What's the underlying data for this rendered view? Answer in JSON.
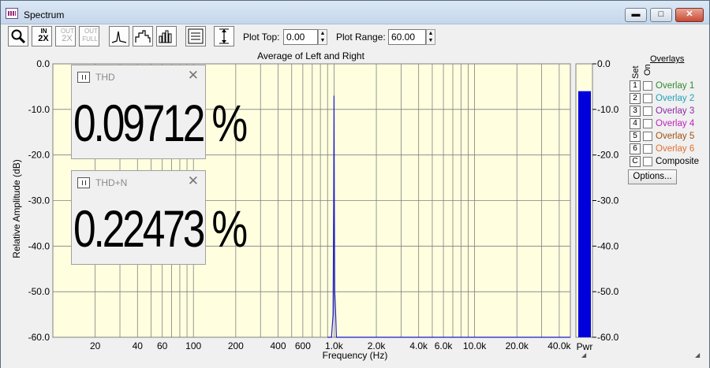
{
  "window": {
    "title": "Spectrum",
    "minimize": "▬",
    "maximize": "□",
    "close": "✕"
  },
  "toolbar": {
    "zoom_icon": "magnifier-icon",
    "zoom_in_2x": {
      "top": "IN",
      "bottom": "2X"
    },
    "zoom_out_2x": {
      "top": "OUT",
      "bottom": "2X"
    },
    "zoom_out_full": {
      "top": "OUT",
      "bottom": "FULL"
    },
    "plot_top_label": "Plot Top:",
    "plot_top_value": "0.00",
    "plot_range_label": "Plot Range:",
    "plot_range_value": "60.00"
  },
  "chart_data": {
    "type": "line",
    "title": "Average of Left and Right",
    "xlabel": "Frequency (Hz)",
    "ylabel": "Relative Amplitude (dB)",
    "x_scale": "log",
    "xlim": [
      10,
      48000
    ],
    "ylim": [
      -60,
      0
    ],
    "grid": true,
    "x_ticks": [
      {
        "value": 20,
        "label": "20"
      },
      {
        "value": 40,
        "label": "40"
      },
      {
        "value": 60,
        "label": "60"
      },
      {
        "value": 100,
        "label": "100"
      },
      {
        "value": 200,
        "label": "200"
      },
      {
        "value": 400,
        "label": "400"
      },
      {
        "value": 600,
        "label": "600"
      },
      {
        "value": 1000,
        "label": "1.0k"
      },
      {
        "value": 2000,
        "label": "2.0k"
      },
      {
        "value": 4000,
        "label": "4.0k"
      },
      {
        "value": 6000,
        "label": "6.0k"
      },
      {
        "value": 10000,
        "label": "10.0k"
      },
      {
        "value": 20000,
        "label": "20.0k"
      },
      {
        "value": 40000,
        "label": "40.0k"
      }
    ],
    "y_ticks": [
      {
        "value": 0,
        "label": "0.0"
      },
      {
        "value": -10,
        "label": "-10.0"
      },
      {
        "value": -20,
        "label": "-20.0"
      },
      {
        "value": -30,
        "label": "-30.0"
      },
      {
        "value": -40,
        "label": "-40.0"
      },
      {
        "value": -50,
        "label": "-50.0"
      },
      {
        "value": -60,
        "label": "-60.0"
      }
    ],
    "series": [
      {
        "color": "#1a1acc",
        "points": [
          [
            900,
            -60
          ],
          [
            960,
            -60
          ],
          [
            985,
            -55
          ],
          [
            995,
            -30
          ],
          [
            1000,
            -7
          ],
          [
            1005,
            -30
          ],
          [
            1012,
            -50
          ],
          [
            1025,
            -54
          ],
          [
            1040,
            -60
          ],
          [
            48000,
            -60
          ]
        ]
      }
    ],
    "power_meter": {
      "label": "Pwr",
      "value": -6,
      "color": "#0000dd"
    }
  },
  "readouts": [
    {
      "title": "THD",
      "value": "0.09712 %"
    },
    {
      "title": "THD+N",
      "value": "0.22473 %"
    }
  ],
  "overlays": {
    "header": "Overlays",
    "set_label": "Set",
    "on_label": "On",
    "items": [
      {
        "num": "1",
        "label": "Overlay 1",
        "color": "#2e8b2e"
      },
      {
        "num": "2",
        "label": "Overlay 2",
        "color": "#20a0b8"
      },
      {
        "num": "3",
        "label": "Overlay 3",
        "color": "#8a2aa8"
      },
      {
        "num": "4",
        "label": "Overlay 4",
        "color": "#c020c0"
      },
      {
        "num": "5",
        "label": "Overlay 5",
        "color": "#a05010"
      },
      {
        "num": "6",
        "label": "Overlay 6",
        "color": "#e07030"
      },
      {
        "num": "C",
        "label": "Composite",
        "color": "#000000"
      }
    ],
    "options_label": "Options..."
  },
  "colors": {
    "plot_bg": "#ffffe0",
    "grid": "#7f7f7f",
    "trace": "#1a1acc",
    "meter": "#0000dd"
  }
}
